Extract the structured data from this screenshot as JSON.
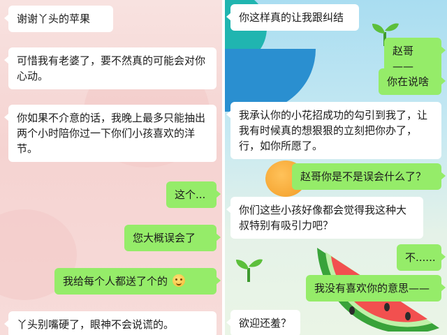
{
  "left_chat": {
    "messages": [
      {
        "side": "in",
        "text": "谢谢丫头的苹果"
      },
      {
        "side": "in",
        "text": "可惜我有老婆了，要不然真的可能会对你心动。"
      },
      {
        "side": "in",
        "text": "你如果不介意的话，我晚上最多只能抽出两个小时陪你过一下你们小孩喜欢的洋节。"
      },
      {
        "side": "out",
        "text": "这个..."
      },
      {
        "side": "out",
        "text": "您大概误会了"
      },
      {
        "side": "out",
        "text": "我给每个人都送了个的",
        "emoji": "embarrassed-face-emoji"
      },
      {
        "side": "in",
        "text": "丫头别嘴硬了，眼神不会说谎的。"
      }
    ]
  },
  "right_chat": {
    "messages": [
      {
        "side": "in",
        "text": "你这样真的让我跟纠结"
      },
      {
        "side": "out",
        "text": "赵哥——"
      },
      {
        "side": "out",
        "text": "你在说啥"
      },
      {
        "side": "in",
        "text": "我承认你的小花招成功的勾引到我了，让我有时候真的想狠狠的立刻把你办了，行，如你所愿了。"
      },
      {
        "side": "out",
        "text": "赵哥你是不是误会什么了？"
      },
      {
        "side": "in",
        "text": "你们这些小孩好像都会觉得我这种大叔特别有吸引力吧？"
      },
      {
        "side": "out",
        "text": "不......"
      },
      {
        "side": "out",
        "text": "我没有喜欢你的意思——"
      },
      {
        "side": "in",
        "text": "欲迎还羞？"
      }
    ]
  },
  "colors": {
    "incoming_bubble": "#ffffff",
    "outgoing_bubble": "#95ec69",
    "left_background": "#f6d6d4",
    "right_background": "#bfe6f1"
  }
}
